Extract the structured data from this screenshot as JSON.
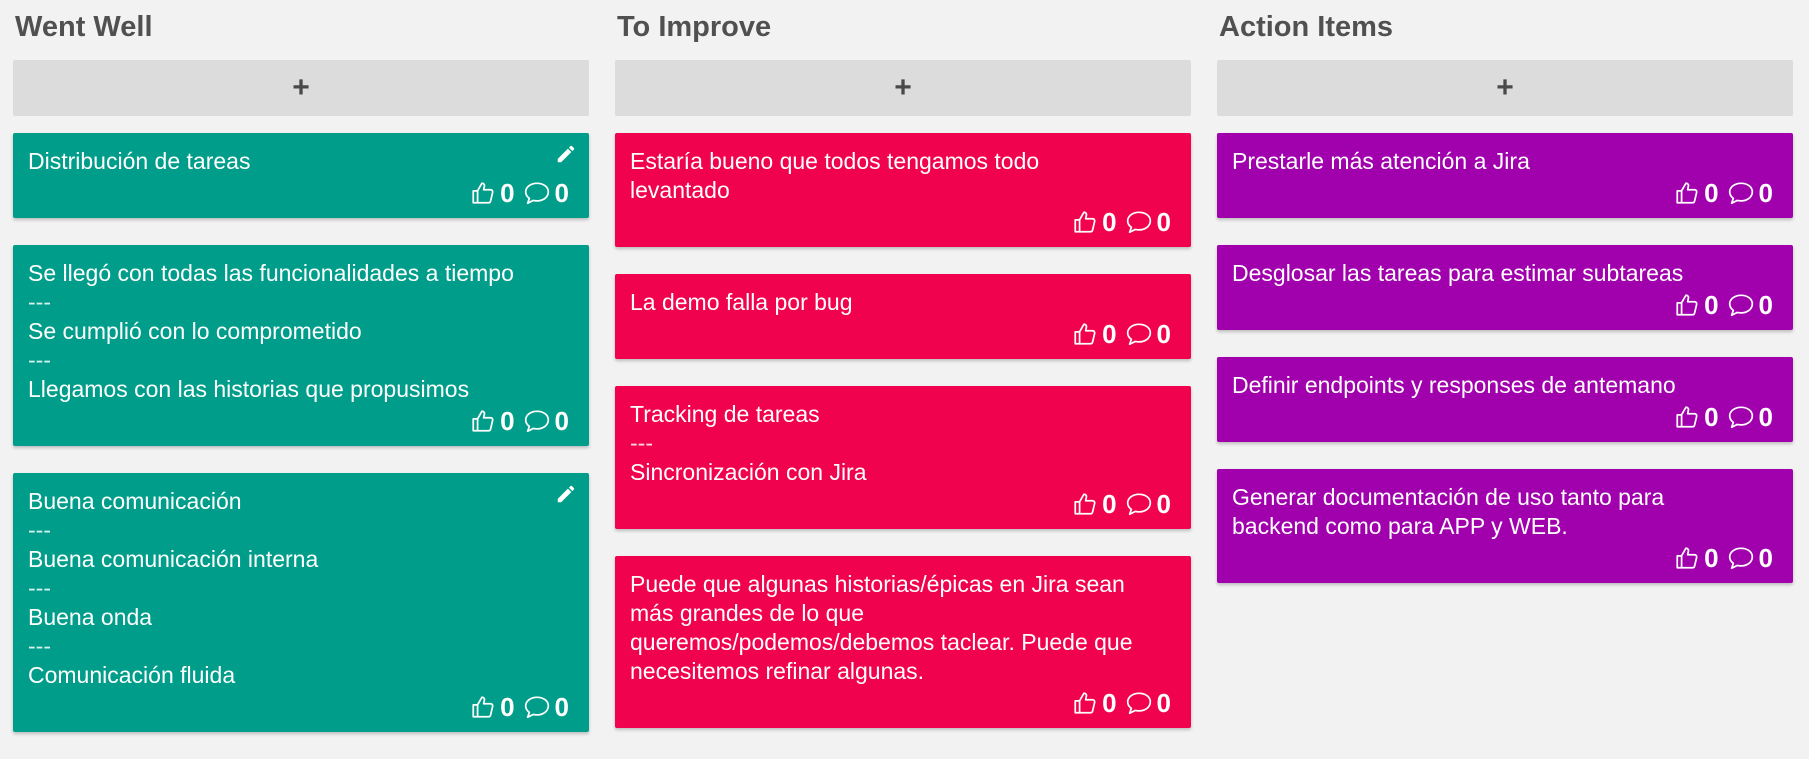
{
  "colors": {
    "went_well": "#009e8a",
    "to_improve": "#f0024e",
    "action_items": "#a100ad",
    "background": "#f2f2f2"
  },
  "icons": {
    "like": "thumbs-up-icon",
    "comment": "comment-icon",
    "edit": "pencil-icon",
    "add": "plus-icon"
  },
  "columns": [
    {
      "title": "Went Well",
      "add_label": "+",
      "color": "green",
      "cards": [
        {
          "lines": [
            "Distribución de tareas"
          ],
          "likes": "0",
          "comments": "0",
          "editable": true
        },
        {
          "lines": [
            "Se llegó con todas las funcionalidades a tiempo",
            "---",
            "Se cumplió con lo comprometido",
            "---",
            "Llegamos con las historias que propusimos"
          ],
          "likes": "0",
          "comments": "0",
          "editable": false
        },
        {
          "lines": [
            "Buena comunicación",
            "---",
            "Buena comunicación interna",
            "---",
            "Buena onda",
            "---",
            "Comunicación fluida"
          ],
          "likes": "0",
          "comments": "0",
          "editable": true
        }
      ]
    },
    {
      "title": "To Improve",
      "add_label": "+",
      "color": "red",
      "cards": [
        {
          "lines": [
            "Estaría bueno que todos tengamos todo levantado"
          ],
          "likes": "0",
          "comments": "0",
          "editable": false
        },
        {
          "lines": [
            "La demo falla por bug"
          ],
          "likes": "0",
          "comments": "0",
          "editable": false
        },
        {
          "lines": [
            "Tracking de tareas",
            "---",
            "Sincronización con Jira"
          ],
          "likes": "0",
          "comments": "0",
          "editable": false
        },
        {
          "lines": [
            "Puede que algunas historias/épicas en Jira sean más grandes de lo que queremos/podemos/debemos taclear. Puede que necesitemos refinar algunas."
          ],
          "likes": "0",
          "comments": "0",
          "editable": false
        }
      ]
    },
    {
      "title": "Action Items",
      "add_label": "+",
      "color": "purple",
      "cards": [
        {
          "lines": [
            "Prestarle más atención a Jira"
          ],
          "likes": "0",
          "comments": "0",
          "editable": false
        },
        {
          "lines": [
            "Desglosar las tareas para estimar subtareas"
          ],
          "likes": "0",
          "comments": "0",
          "editable": false
        },
        {
          "lines": [
            "Definir endpoints y responses de antemano"
          ],
          "likes": "0",
          "comments": "0",
          "editable": false
        },
        {
          "lines": [
            "Generar documentación de uso tanto para backend como para APP y WEB."
          ],
          "likes": "0",
          "comments": "0",
          "editable": false
        }
      ]
    }
  ]
}
